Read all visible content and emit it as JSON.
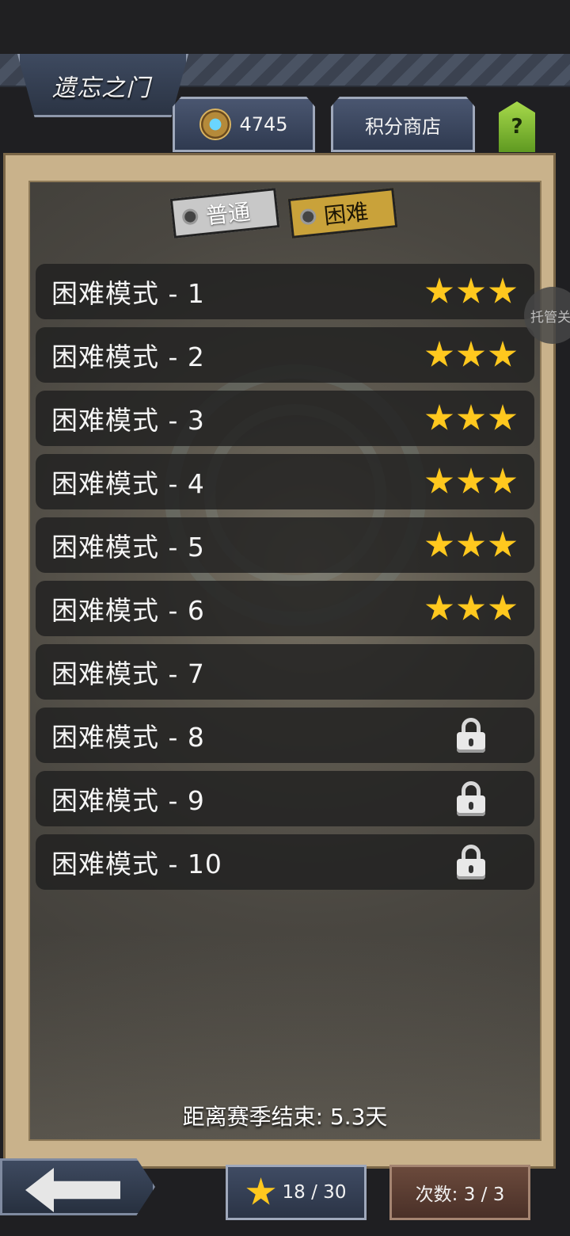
{
  "header": {
    "title": "遗忘之门",
    "currency_value": "4745",
    "shop_label": "积分商店",
    "help_label": "?"
  },
  "mode_tabs": {
    "normal_label": "普通",
    "hard_label": "困难",
    "selected": "困难"
  },
  "levels": [
    {
      "name": "困难模式 - 1",
      "stars": 3,
      "locked": false
    },
    {
      "name": "困难模式 - 2",
      "stars": 3,
      "locked": false
    },
    {
      "name": "困难模式 - 3",
      "stars": 3,
      "locked": false
    },
    {
      "name": "困难模式 - 4",
      "stars": 3,
      "locked": false
    },
    {
      "name": "困难模式 - 5",
      "stars": 3,
      "locked": false
    },
    {
      "name": "困难模式 - 6",
      "stars": 3,
      "locked": false
    },
    {
      "name": "困难模式 - 7",
      "stars": 0,
      "locked": false
    },
    {
      "name": "困难模式 - 8",
      "stars": 0,
      "locked": true
    },
    {
      "name": "困难模式 - 9",
      "stars": 0,
      "locked": true
    },
    {
      "name": "困难模式 - 10",
      "stars": 0,
      "locked": true
    }
  ],
  "auto_button_label": "托管关",
  "season_text": "距离赛季结束: 5.3天",
  "footer": {
    "stars_progress": "18 / 30",
    "attempts": "次数: 3 / 3"
  },
  "colors": {
    "star": "#ffc81e",
    "hard_tab": "#c9a23a",
    "board_frame": "#c9b28b",
    "help_button": "#8ac43a"
  },
  "icons": {
    "currency": "gem-medal-icon",
    "star": "star-icon",
    "lock": "lock-icon",
    "back": "back-arrow-icon"
  }
}
